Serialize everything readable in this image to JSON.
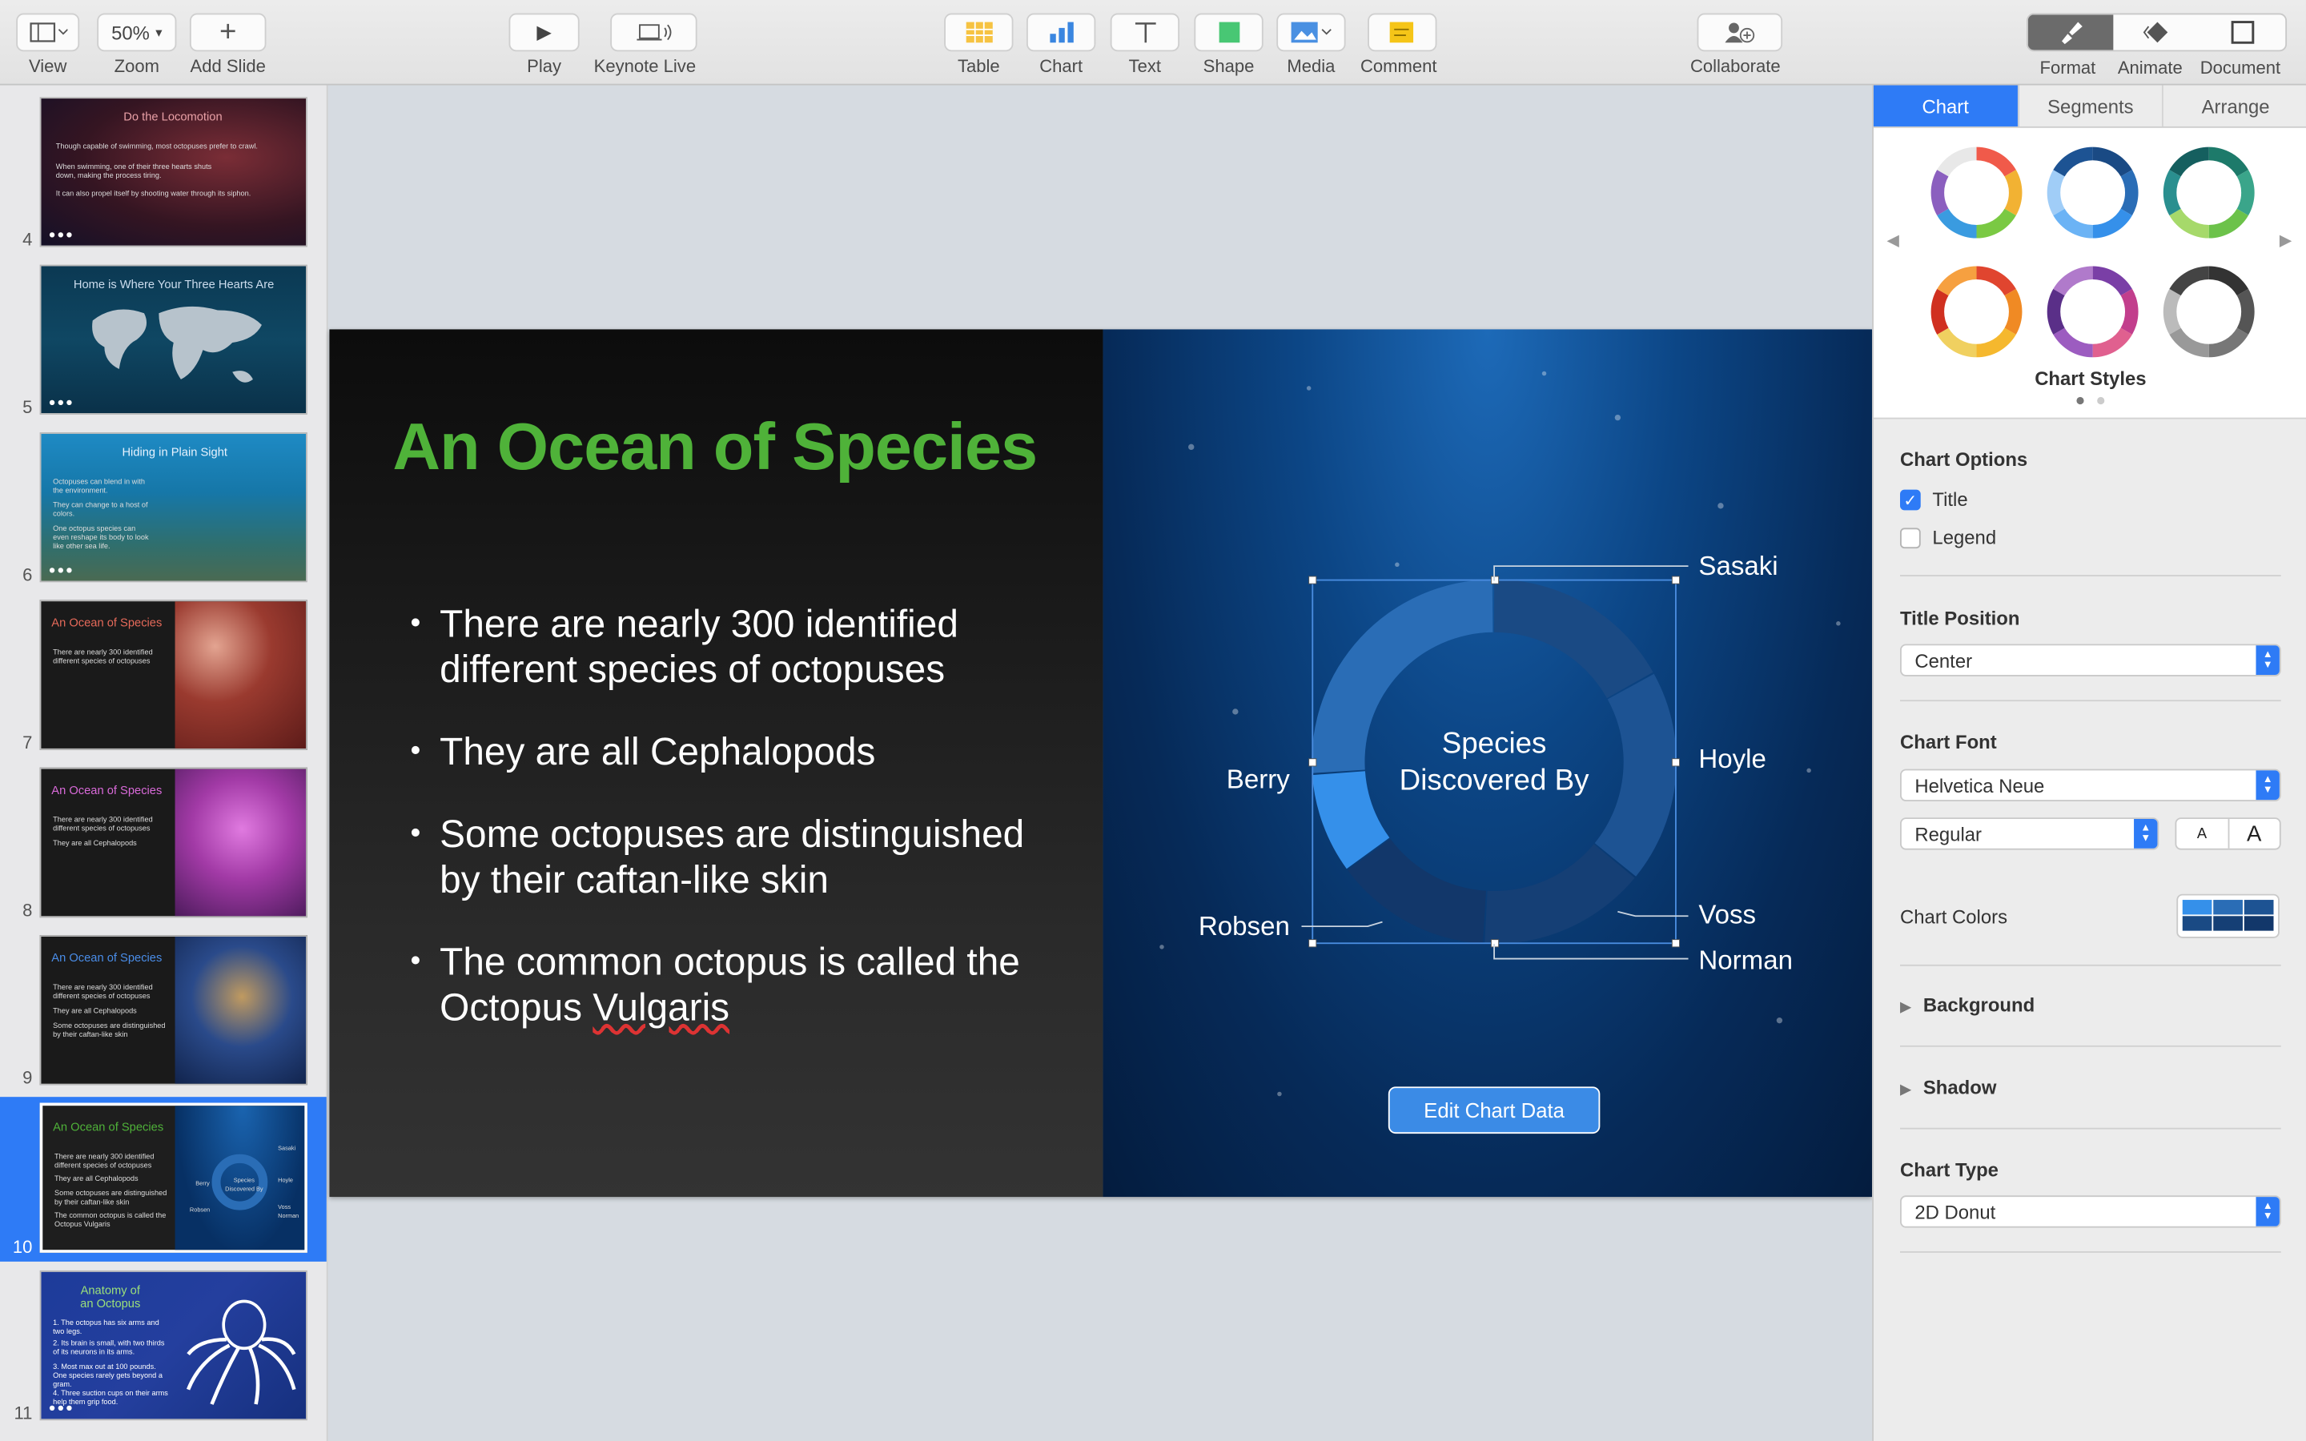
{
  "toolbar": {
    "view": "View",
    "zoom_value": "50%",
    "zoom": "Zoom",
    "add_slide": "Add Slide",
    "play": "Play",
    "keynote_live": "Keynote Live",
    "table": "Table",
    "chart": "Chart",
    "text": "Text",
    "shape": "Shape",
    "media": "Media",
    "comment": "Comment",
    "collaborate": "Collaborate",
    "format": "Format",
    "animate": "Animate",
    "document": "Document"
  },
  "slides": [
    {
      "num": "4",
      "title": "Do the Locomotion",
      "lines": [
        "Though capable of swimming, most octopuses prefer to crawl.",
        "When swimming, one of their three hearts shuts down, making the process tiring.",
        "It can also propel itself by shooting water through its siphon."
      ]
    },
    {
      "num": "5",
      "title": "Home is Where Your Three Hearts Are",
      "lines": []
    },
    {
      "num": "6",
      "title": "Hiding in Plain Sight",
      "lines": [
        "Octopuses can blend in with the environment.",
        "They can change to a host of colors.",
        "One octopus species can even reshape its body to look like other sea life."
      ]
    },
    {
      "num": "7",
      "title": "An Ocean of Species",
      "lines": [
        "There are nearly 300 identified different species of octopuses"
      ]
    },
    {
      "num": "8",
      "title": "An Ocean of Species",
      "lines": [
        "There are nearly 300 identified different species of octopuses",
        "They are all Cephalopods"
      ]
    },
    {
      "num": "9",
      "title": "An Ocean of Species",
      "lines": [
        "There are nearly 300 identified different species of octopuses",
        "They are all Cephalopods",
        "Some octopuses are distinguished by their caftan-like skin"
      ]
    },
    {
      "num": "10",
      "title": "An Ocean of Species",
      "lines": [
        "There are nearly 300 identified different species of octopuses",
        "They are all Cephalopods",
        "Some octopuses are distinguished by their caftan-like skin",
        "The common octopus is called the Octopus Vulgaris"
      ],
      "mini_chart_title": "Species Discovered By",
      "mini_labels": [
        "Sasaki",
        "Berry",
        "Hoyle",
        "Robsen",
        "Voss",
        "Norman"
      ]
    },
    {
      "num": "11",
      "title": "Anatomy of an Octopus",
      "lines": [
        "1. The octopus has six arms and two legs.",
        "2. Its brain is small, with two thirds of its neurons in its arms.",
        "3. Most max out at 100 pounds. One species rarely gets beyond a gram.",
        "4. Three suction cups on their arms help them grip food."
      ]
    }
  ],
  "slide": {
    "title": "An Ocean of Species",
    "bullets": [
      {
        "a": "There are nearly 300 identified different species of octopuses",
        "b": ""
      },
      {
        "a": "They are all Cephalopods",
        "b": ""
      },
      {
        "a": "Some octopuses are distinguished by their caftan-like skin",
        "b": ""
      },
      {
        "a": "The common octopus is called the Octopus ",
        "b": "Vulgaris"
      }
    ],
    "edit_chart_data": "Edit Chart Data"
  },
  "chart_data": {
    "type": "pie",
    "subtype": "2D Donut",
    "title": "Species Discovered By",
    "title_lines": [
      "Species",
      "Discovered By"
    ],
    "categories": [
      "Sasaki",
      "Hoyle",
      "Voss",
      "Norman",
      "Robsen",
      "Berry"
    ],
    "values": [
      17,
      19,
      15,
      14,
      9,
      26
    ],
    "colors": [
      "#1a4a84",
      "#1d5393",
      "#153f75",
      "#12376a",
      "#3590ea",
      "#2a6db6"
    ],
    "legend": false
  },
  "inspector": {
    "tabs": [
      "Chart",
      "Segments",
      "Arrange"
    ],
    "chart_styles": "Chart Styles",
    "chart_options": "Chart Options",
    "title_cb": "Title",
    "legend_cb": "Legend",
    "title_position": "Title Position",
    "title_position_value": "Center",
    "chart_font": "Chart Font",
    "font_value": "Helvetica Neue",
    "font_style": "Regular",
    "font_small": "A",
    "font_large": "A",
    "chart_colors": "Chart Colors",
    "background": "Background",
    "shadow": "Shadow",
    "chart_type": "Chart Type",
    "chart_type_value": "2D Donut"
  }
}
